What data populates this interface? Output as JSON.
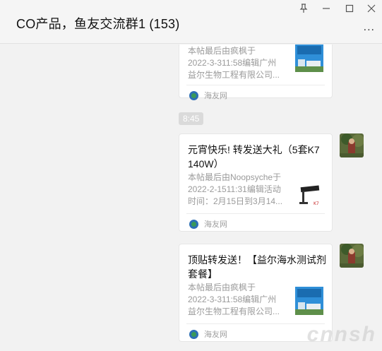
{
  "window": {
    "title": "CO产品，鱼友交流群1 (153)",
    "pin_icon": "pin-icon",
    "min_icon": "minimize-icon",
    "max_icon": "maximize-icon",
    "close_icon": "close-icon",
    "more_label": "..."
  },
  "messages": [
    {
      "title": "",
      "desc": [
        "本帖最后由疯枫于",
        "2022-3-311:58编辑广州",
        "益尔生物工程有限公司..."
      ],
      "source": "海友网"
    },
    {
      "title": "元宵快乐! 转发送大礼（5套K7 140W）",
      "desc": [
        "本帖最后由Noopsyche于",
        "2022-2-1511:31编辑活动",
        "时间：2月15日到3月14..."
      ],
      "source": "海友网"
    },
    {
      "title": "顶贴转发送！【益尔海水测试剂套餐】",
      "desc": [
        "本帖最后由疯枫于",
        "2022-3-311:58编辑广州",
        "益尔生物工程有限公司..."
      ],
      "source": "海友网"
    }
  ],
  "time_divider": "8:45",
  "watermark": "cnnsh"
}
